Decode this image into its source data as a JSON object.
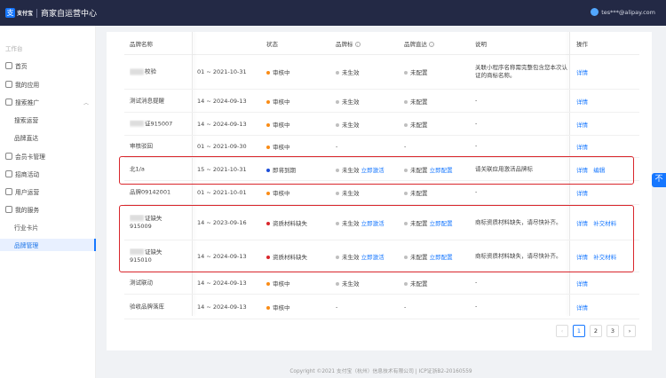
{
  "header": {
    "logo_text": "支付宝",
    "title": "商家自运营中心",
    "user": "tes***@alipay.com"
  },
  "sidebar": {
    "group": "工作台",
    "items": [
      {
        "label": "首页"
      },
      {
        "label": "我的应用"
      },
      {
        "label": "搜索推广"
      },
      {
        "label": "搜索运营"
      },
      {
        "label": "品牌直达"
      },
      {
        "label": "会员卡管理"
      },
      {
        "label": "招商活动"
      },
      {
        "label": "用户运营"
      },
      {
        "label": "我的服务"
      },
      {
        "label": "行业卡片"
      },
      {
        "label": "品牌管理"
      }
    ]
  },
  "table": {
    "headers": {
      "brand_name": "品牌名称",
      "status": "状态",
      "brand_mark": "品牌标",
      "brand_direct": "品牌直达",
      "desc": "说明",
      "actions": "操作"
    },
    "rows": [
      {
        "name": "校验",
        "period": "01 ~ 2021-10-31",
        "status": "审核中",
        "mark": "未生效",
        "mark_link": "",
        "direct": "未配置",
        "direct_link": "",
        "desc": "关联小程序名称需完整包含您本次认证的商标名称。",
        "a1": "详情",
        "a2": ""
      },
      {
        "name": "测试消息提醒",
        "period": "14 ~ 2024-09-13",
        "status": "审核中",
        "mark": "未生效",
        "mark_link": "",
        "direct": "未配置",
        "direct_link": "",
        "desc": "-",
        "a1": "详情",
        "a2": ""
      },
      {
        "name": "证915007",
        "period": "14 ~ 2024-09-13",
        "status": "审核中",
        "mark": "未生效",
        "mark_link": "",
        "direct": "未配置",
        "direct_link": "",
        "desc": "-",
        "a1": "详情",
        "a2": ""
      },
      {
        "name": "审核驳回",
        "period": "01 ~ 2021-09-30",
        "status": "审核中",
        "mark": "-",
        "mark_link": "",
        "direct": "-",
        "direct_link": "",
        "desc": "-",
        "a1": "详情",
        "a2": ""
      },
      {
        "name": "北1/a",
        "period": "15 ~ 2021-10-31",
        "status": "即将到期",
        "mark": "未生效",
        "mark_link": "立即激活",
        "direct": "未配置",
        "direct_link": "立即配置",
        "desc": "请关联应用激活品牌标",
        "a1": "详情",
        "a2": "编辑"
      },
      {
        "name": "品牌09142001",
        "period": "01 ~ 2021-10-01",
        "status": "审核中",
        "mark": "未生效",
        "mark_link": "",
        "direct": "未配置",
        "direct_link": "",
        "desc": "-",
        "a1": "详情",
        "a2": ""
      },
      {
        "name": "证缺失",
        "name2": "915009",
        "period": "14 ~ 2023-09-16",
        "status": "资质材料缺失",
        "mark": "未生效",
        "mark_link": "立即激活",
        "direct": "未配置",
        "direct_link": "立即配置",
        "desc": "商标资质材料缺失，请尽快补齐。",
        "a1": "详情",
        "a2": "补交材料"
      },
      {
        "name": "证缺失",
        "name2": "915010",
        "period": "14 ~ 2024-09-13",
        "status": "资质材料缺失",
        "mark": "未生效",
        "mark_link": "立即激活",
        "direct": "未配置",
        "direct_link": "立即配置",
        "desc": "商标资质材料缺失，请尽快补齐。",
        "a1": "详情",
        "a2": "补交材料"
      },
      {
        "name": "测试联动",
        "period": "14 ~ 2024-09-13",
        "status": "审核中",
        "mark": "未生效",
        "mark_link": "",
        "direct": "未配置",
        "direct_link": "",
        "desc": "-",
        "a1": "详情",
        "a2": ""
      },
      {
        "name": "验收品牌落库",
        "period": "14 ~ 2024-09-13",
        "status": "审核中",
        "mark": "-",
        "mark_link": "",
        "direct": "-",
        "direct_link": "",
        "desc": "-",
        "a1": "详情",
        "a2": ""
      }
    ]
  },
  "pagination": {
    "pages": [
      "1",
      "2",
      "3"
    ],
    "prev": "‹",
    "next": "›"
  },
  "footer": "Copyright ©2021 支付宝（杭州）信息技术有限公司 | ICP证浙B2-20160559",
  "float_button": "不",
  "colors": {
    "accent": "#1677ff",
    "reviewing": "#fa8c16",
    "expiring": "#1d4ed8",
    "missing": "#d9262c",
    "inactive": "#bfbfbf"
  }
}
